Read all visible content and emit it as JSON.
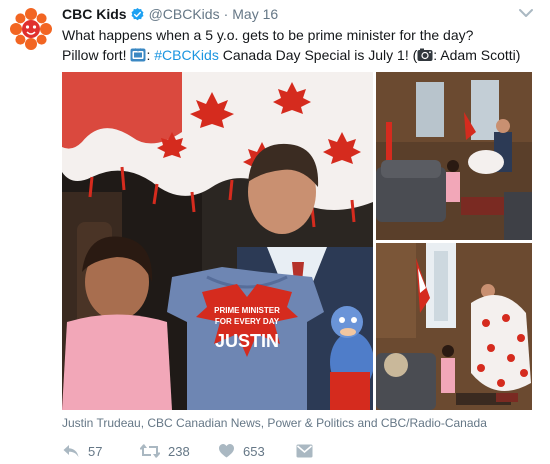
{
  "tweet": {
    "display_name": "CBC Kids",
    "handle": "@CBCKids",
    "separator": "·",
    "date": "May 16",
    "text_line1": "What happens when a 5 y.o. gets to be prime minister for the day?",
    "text_line2_a": "Pillow fort! ",
    "text_line2_b": ": ",
    "hashtag": "#CBCKids",
    "text_line2_c": " Canada Day Special is July 1! (",
    "text_line2_d": ": Adam Scotti)",
    "icons": {
      "avatar": "cbc-kids-gem-logo",
      "verified": "verified-badge-icon",
      "caret": "chevron-down-icon",
      "tv": "tv-icon",
      "camera": "camera-icon",
      "reply": "reply-icon",
      "retweet": "retweet-icon",
      "like": "heart-icon",
      "message": "direct-message-icon"
    },
    "photo_credit": "Justin Trudeau, CBC Canadian News, Power & Politics and CBC/Radio-Canada",
    "shirt_text": {
      "line1": "PRIME MINISTER",
      "line2": "FOR EVERY DAY",
      "line3": "JUSTIN"
    },
    "actions": {
      "replies": "57",
      "retweets": "238",
      "likes": "653"
    },
    "colors": {
      "text": "#14171a",
      "muted": "#657786",
      "link": "#1b95e0",
      "verified": "#1da1f2",
      "canada_red": "#d52b1e"
    }
  }
}
